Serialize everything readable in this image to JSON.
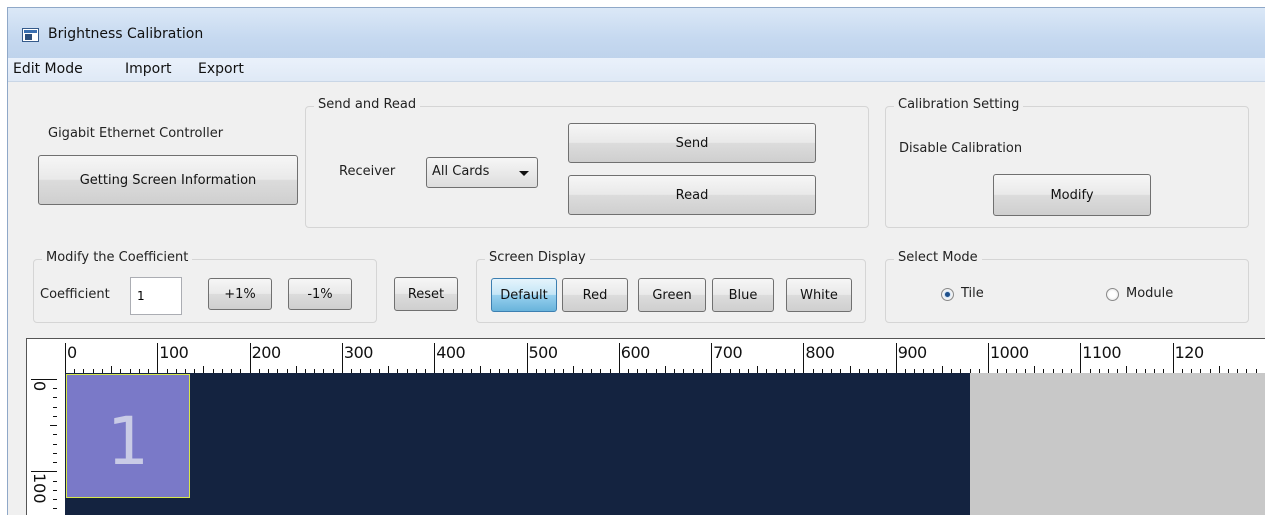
{
  "window": {
    "title": "Brightness Calibration"
  },
  "menu": [
    "Edit Mode",
    "Import",
    "Export"
  ],
  "controller": {
    "label": "Gigabit Ethernet Controller",
    "button": "Getting Screen Information"
  },
  "send_read": {
    "title": "Send and Read",
    "receiver_label": "Receiver",
    "receiver_value": "All Cards",
    "send": "Send",
    "read": "Read"
  },
  "calibration_setting": {
    "title": "Calibration Setting",
    "status": "Disable Calibration",
    "modify": "Modify"
  },
  "coefficient": {
    "title": "Modify the Coefficient",
    "label": "Coefficient",
    "value": "1",
    "plus": "+1%",
    "minus": "-1%"
  },
  "reset": "Reset",
  "screen_display": {
    "title": "Screen Display",
    "buttons": [
      "Default",
      "Red",
      "Green",
      "Blue",
      "White"
    ],
    "active": "Default"
  },
  "select_mode": {
    "title": "Select Mode",
    "options": [
      "Tile",
      "Module"
    ],
    "selected": "Tile"
  },
  "ruler": {
    "horizontal": [
      "0",
      "100",
      "200",
      "300",
      "400",
      "500",
      "600",
      "700",
      "800",
      "900",
      "1000",
      "1100",
      "120"
    ],
    "vertical": [
      "0",
      "100"
    ]
  },
  "tile": {
    "number": "1"
  },
  "colors": {
    "screen": "#142340",
    "tile": "#7a79c8",
    "tile_border": "#d8e84c",
    "unused_area": "#c8c8c8"
  }
}
